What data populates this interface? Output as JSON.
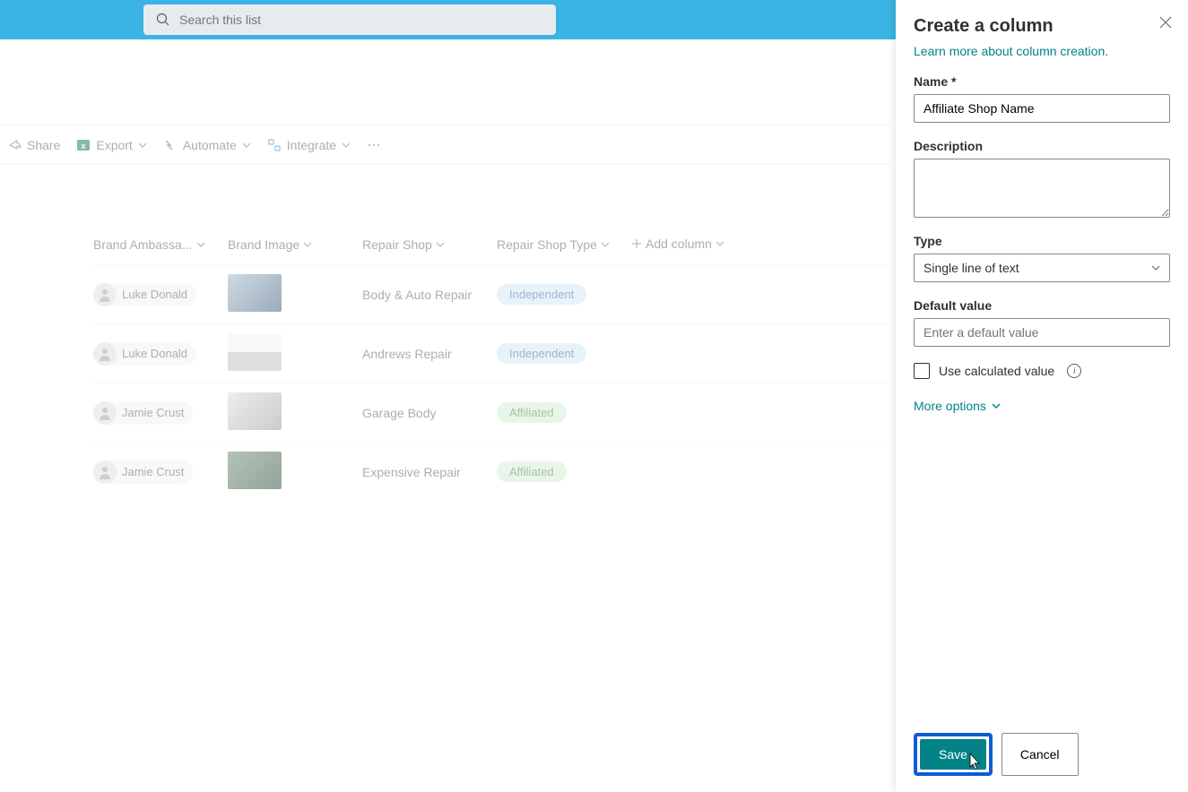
{
  "search": {
    "placeholder": "Search this list"
  },
  "cmdbar": {
    "share": "Share",
    "export": "Export",
    "automate": "Automate",
    "integrate": "Integrate"
  },
  "headers": {
    "ambassador": "Brand Ambassa...",
    "image": "Brand Image",
    "shop": "Repair Shop",
    "shoptype": "Repair Shop Type",
    "addcol": "Add column"
  },
  "rows": [
    {
      "person": "Luke Donald",
      "shop": "Body & Auto Repair",
      "type": "Independent",
      "type_class": "ind",
      "img": "a"
    },
    {
      "person": "Luke Donald",
      "shop": "Andrews Repair",
      "type": "Independent",
      "type_class": "ind",
      "img": "b"
    },
    {
      "person": "Jamie Crust",
      "shop": "Garage Body",
      "type": "Affiliated",
      "type_class": "aff",
      "img": "c"
    },
    {
      "person": "Jamie Crust",
      "shop": "Expensive Repair",
      "type": "Affiliated",
      "type_class": "aff",
      "img": "d"
    }
  ],
  "panel": {
    "title": "Create a column",
    "learn": "Learn more about column creation.",
    "name_label": "Name *",
    "name_value": "Affiliate Shop Name",
    "desc_label": "Description",
    "type_label": "Type",
    "type_value": "Single line of text",
    "default_label": "Default value",
    "default_placeholder": "Enter a default value",
    "calc_label": "Use calculated value",
    "more": "More options",
    "save": "Save",
    "cancel": "Cancel"
  }
}
